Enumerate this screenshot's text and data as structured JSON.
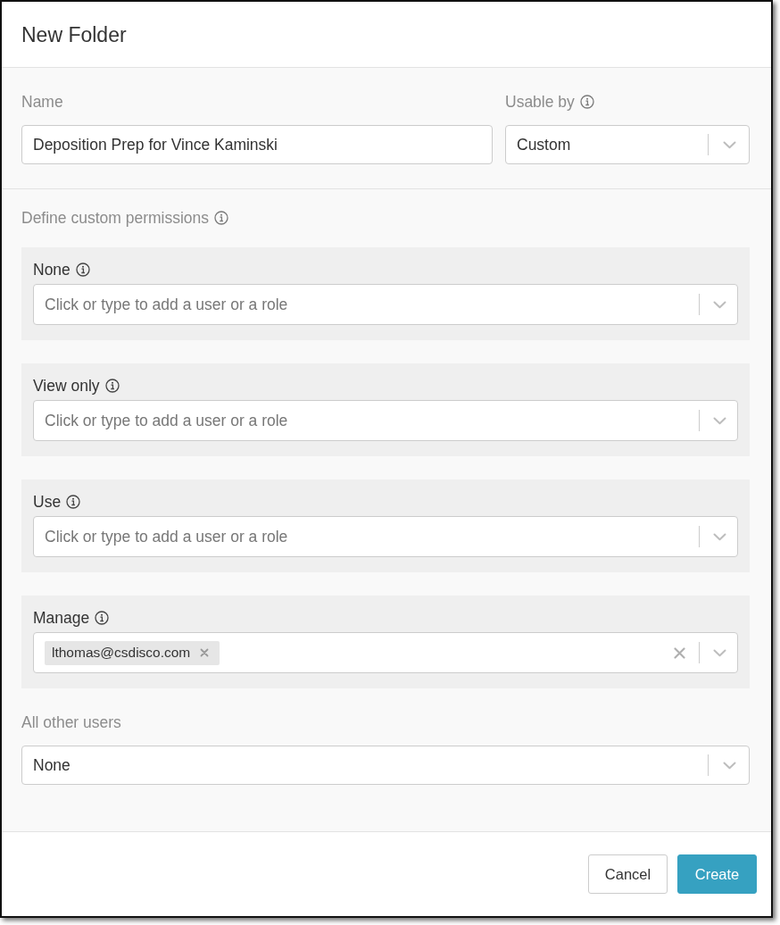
{
  "dialog": {
    "title": "New Folder"
  },
  "name_field": {
    "label": "Name",
    "info": false,
    "value": "Deposition Prep for Vince Kaminski"
  },
  "usable_by": {
    "label": "Usable by",
    "info": true,
    "value": "Custom"
  },
  "custom_permissions": {
    "heading": "Define custom permissions",
    "info": true,
    "groups": [
      {
        "label": "None",
        "info": true,
        "placeholder": "Click or type to add a user or a role"
      },
      {
        "label": "View only",
        "info": true,
        "placeholder": "Click or type to add a user or a role"
      },
      {
        "label": "Use",
        "info": true,
        "placeholder": "Click or type to add a user or a role"
      },
      {
        "label": "Manage",
        "info": true,
        "tags": [
          "lthomas@csdisco.com"
        ]
      }
    ]
  },
  "all_other_users": {
    "label": "All other users",
    "info": false,
    "value": "None"
  },
  "buttons": [
    {
      "label": "Cancel",
      "kind": "secondary"
    },
    {
      "label": "Create",
      "kind": "primary"
    }
  ]
}
